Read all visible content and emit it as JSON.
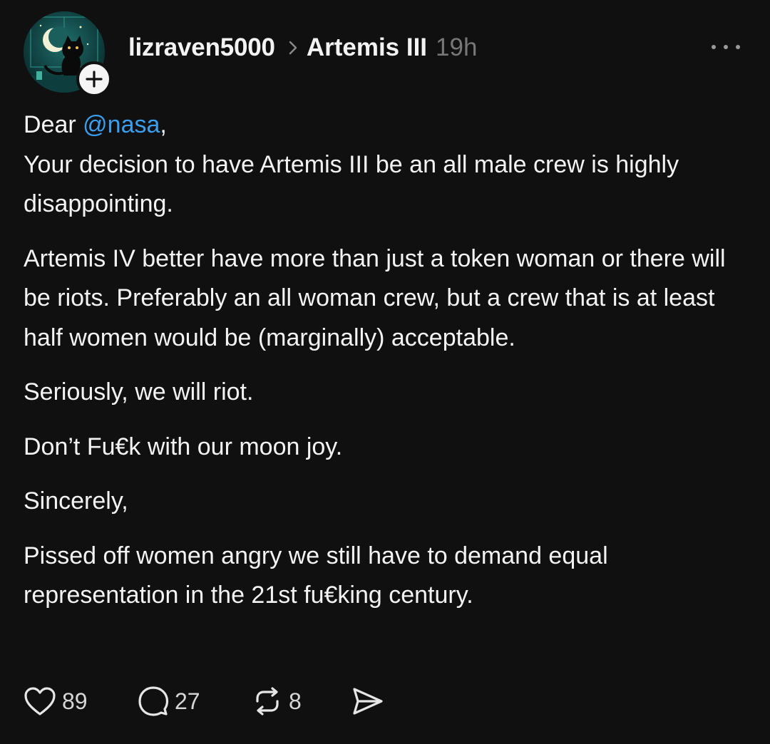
{
  "post": {
    "username": "lizraven5000",
    "topic": "Artemis III",
    "time": "19h",
    "greeting_prefix": "Dear ",
    "mention": "@nasa",
    "greeting_suffix": ",",
    "paragraph1_rest": "Your decision to have Artemis III be an all male crew is highly disappointing.",
    "paragraph2": "Artemis IV better have more than just a token woman or there will be riots. Preferably an all woman crew, but a crew that is at least half women would be (marginally) acceptable.",
    "paragraph3": "Seriously, we will riot.",
    "paragraph4": "Don’t Fu€k with our moon joy.",
    "paragraph5": "Sincerely,",
    "paragraph6": "Pissed off women angry we still have to demand equal representation in the 21st fu€king century."
  },
  "actions": {
    "likes": "89",
    "replies": "27",
    "reposts": "8"
  },
  "icons": {
    "avatar": "avatar-black-cat-moon",
    "follow": "plus-icon",
    "chevron": "chevron-right-icon",
    "more": "more-icon",
    "like": "heart-icon",
    "reply": "comment-icon",
    "repost": "repost-icon",
    "share": "send-icon"
  },
  "colors": {
    "background": "#101010",
    "text": "#f3f3f3",
    "muted": "#777777",
    "mention": "#3b9ff0"
  }
}
